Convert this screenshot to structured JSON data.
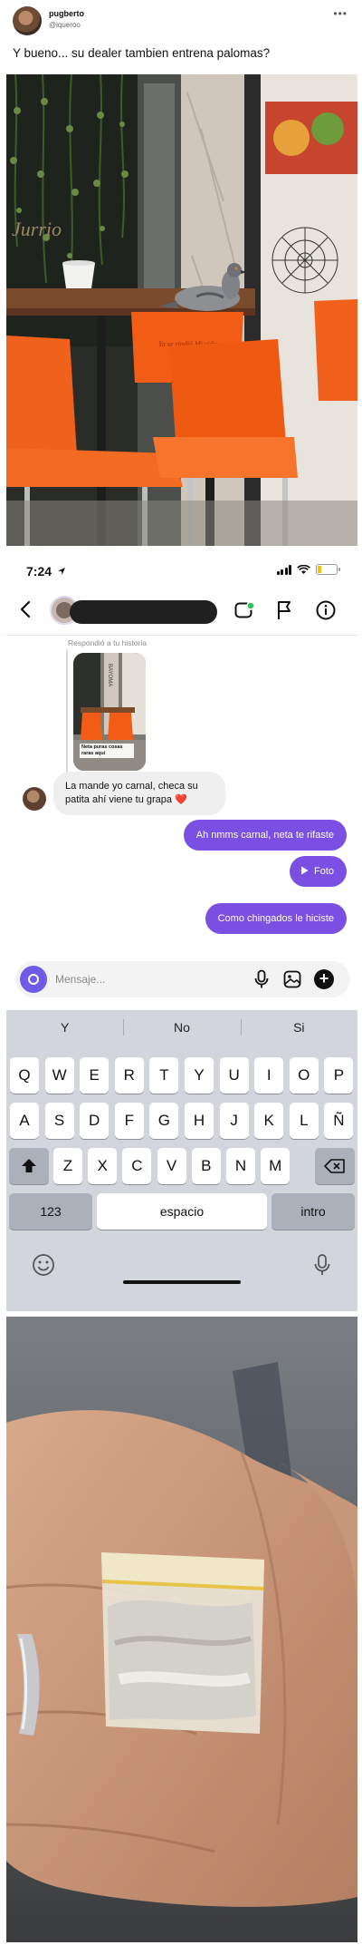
{
  "tweet": {
    "author_name": "pugberto",
    "author_handle": "@iqueroo",
    "text": "Y bueno... su dealer tambien entrena palomas?",
    "more_icon": "more-horizontal-icon"
  },
  "photo_cafe": {
    "wall_text": "Jurrio",
    "table_text": "Ya se rindió Mi vida"
  },
  "phone": {
    "status_time": "7:24",
    "battery_color": "#f2c200",
    "dm": {
      "replied_label": "Respondió a tu historia",
      "story_caption": "Neta puras cosas raras aquí",
      "messages": [
        {
          "direction": "in",
          "text": "La mande yo carnal, checa su patita ahí viene tu grapa ❤️"
        },
        {
          "direction": "out",
          "text": "Ah nmms carnal, neta te rifaste"
        },
        {
          "direction": "out",
          "text": "Foto",
          "icon": "play-icon"
        },
        {
          "direction": "out",
          "text": "Como chingados le hiciste"
        }
      ],
      "composer_placeholder": "Mensaje...",
      "accent_color": "#7b4fe2"
    },
    "keyboard": {
      "suggestions": [
        "Y",
        "No",
        "Si"
      ],
      "rows": [
        [
          "Q",
          "W",
          "E",
          "R",
          "T",
          "Y",
          "U",
          "I",
          "O",
          "P"
        ],
        [
          "A",
          "S",
          "D",
          "F",
          "G",
          "H",
          "J",
          "K",
          "L",
          "Ñ"
        ],
        [
          "Z",
          "X",
          "C",
          "V",
          "B",
          "N",
          "M"
        ]
      ],
      "numbers_key": "123",
      "space_key": "espacio",
      "return_key": "intro"
    }
  }
}
